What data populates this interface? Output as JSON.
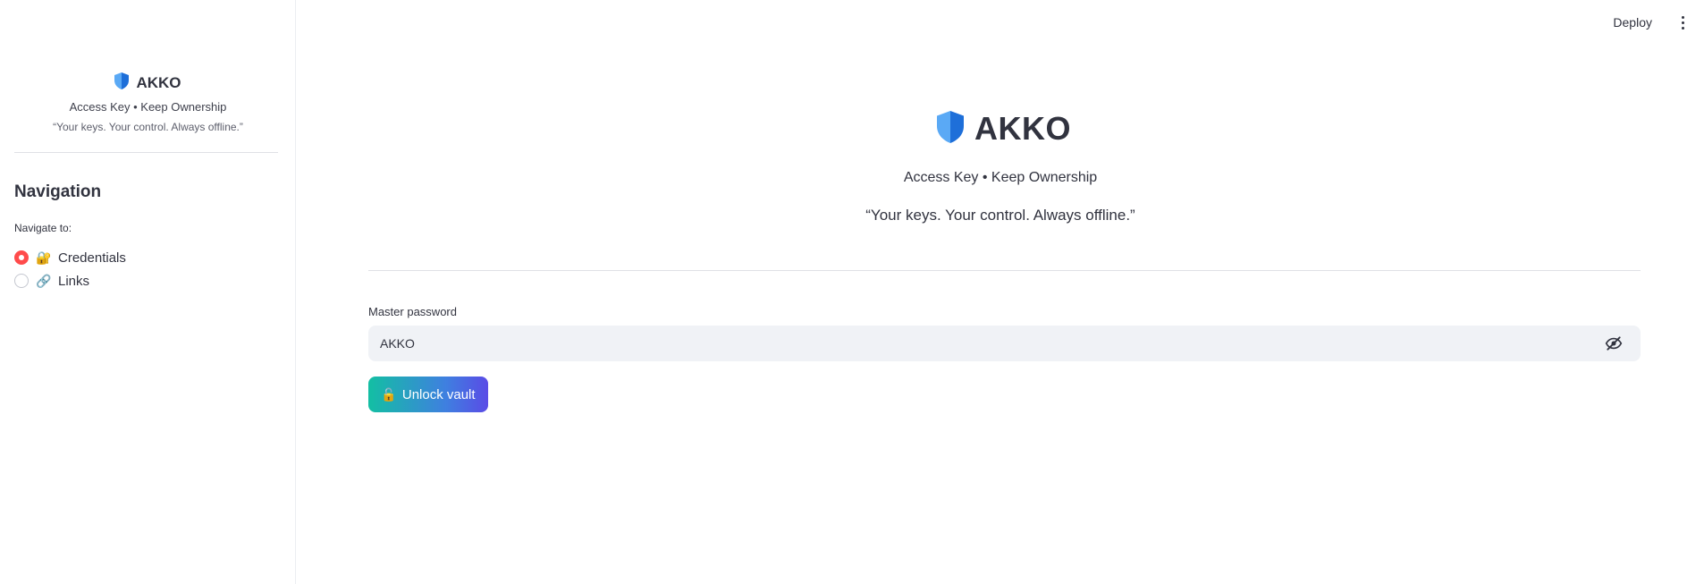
{
  "sidebar": {
    "brand_title": "AKKO",
    "brand_icon": "shield-icon",
    "tagline": "Access Key • Keep Ownership",
    "quote": "“Your keys. Your control. Always offline.”",
    "nav_heading": "Navigation",
    "nav_label": "Navigate to:",
    "nav_items": [
      {
        "icon": "lock-icon",
        "emoji": "🔐",
        "label": "Credentials",
        "selected": true
      },
      {
        "icon": "link-icon",
        "emoji": "🔗",
        "label": "Links",
        "selected": false
      }
    ]
  },
  "topbar": {
    "deploy_label": "Deploy",
    "menu_icon": "kebab-menu-icon"
  },
  "main": {
    "title": "AKKO",
    "title_icon": "shield-icon",
    "tagline": "Access Key • Keep Ownership",
    "quote": "“Your keys. Your control. Always offline.”",
    "password_label": "Master password",
    "password_value": "AKKO",
    "password_toggle_icon": "eye-off-icon",
    "unlock_button": {
      "emoji": "🔓",
      "label": "Unlock vault"
    }
  },
  "colors": {
    "accent": "#ff4b4b",
    "button_gradient_start": "#13bfa3",
    "button_gradient_end": "#5a4be6",
    "shield_light": "#5aa9f5",
    "shield_dark": "#1e6fd9",
    "input_bg": "#f0f2f6"
  }
}
